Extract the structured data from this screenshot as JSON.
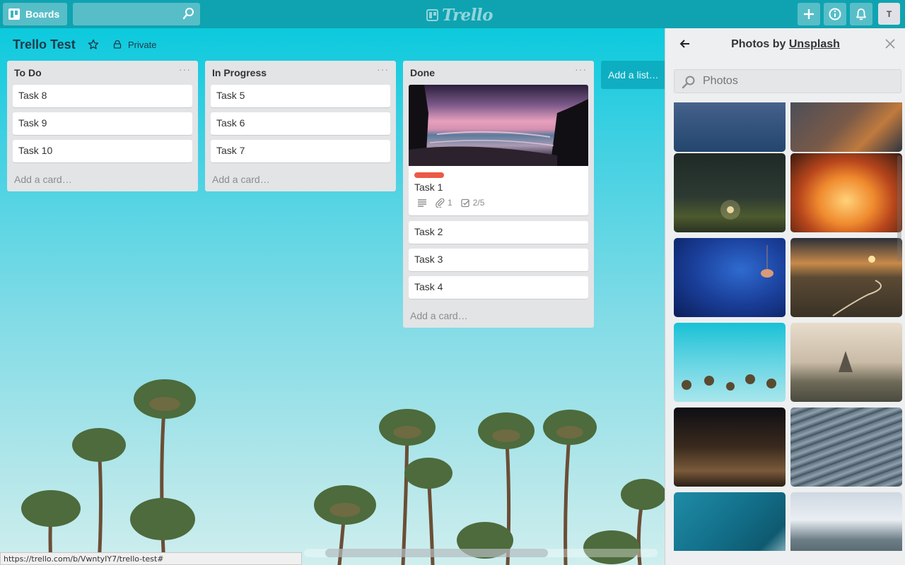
{
  "header": {
    "boards_label": "Boards",
    "search_placeholder": "",
    "logo_text": "Trello",
    "avatar_initial": "T"
  },
  "board": {
    "title": "Trello Test",
    "privacy": "Private"
  },
  "lists": [
    {
      "title": "To Do",
      "menu": "···",
      "cards": [
        "Task 8",
        "Task 9",
        "Task 10"
      ],
      "add_card": "Add a card…"
    },
    {
      "title": "In Progress",
      "menu": "···",
      "cards": [
        "Task 5",
        "Task 6",
        "Task 7"
      ],
      "add_card": "Add a card…"
    },
    {
      "title": "Done",
      "menu": "···",
      "cover_card": {
        "title": "Task 1",
        "label_color": "#eb5a46",
        "attachments": "1",
        "checklist": "2/5"
      },
      "cards": [
        "Task 2",
        "Task 3",
        "Task 4"
      ],
      "add_card": "Add a card…"
    }
  ],
  "add_list": "Add a list…",
  "panel": {
    "title_prefix": "Photos by ",
    "title_link": "Unsplash",
    "search_placeholder": "Photos",
    "photos": [
      "ocean-waves",
      "rocky-coast",
      "night-sky-field",
      "bonfire",
      "jellyfish",
      "winding-road-sunset",
      "palm-trees",
      "temples-misty",
      "city-night",
      "escalator",
      "ocean-aerial",
      "snowy-mountains"
    ]
  },
  "status_url": "https://trello.com/b/VwntyIY7/trello-test#",
  "colors": {
    "header": "#0fa3b1",
    "label_red": "#eb5a46",
    "list_bg": "#e2e4e6"
  }
}
